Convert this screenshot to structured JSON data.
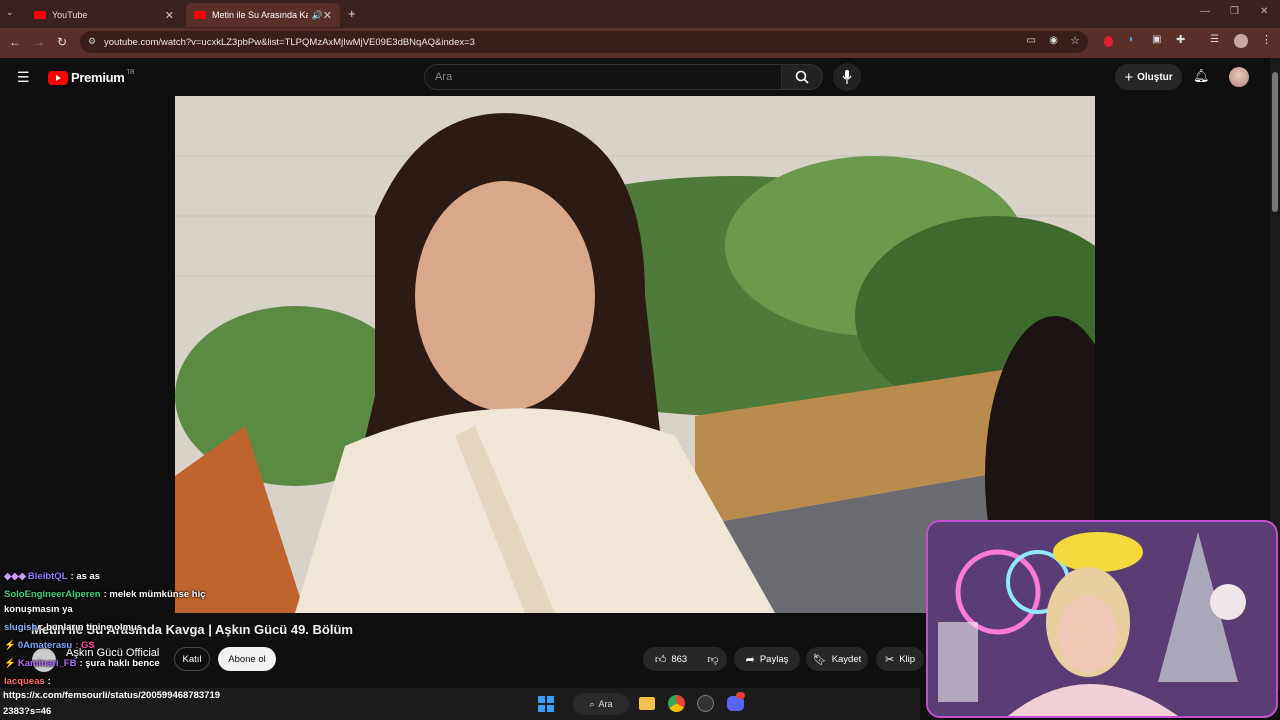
{
  "browser": {
    "tabs": [
      {
        "title": "YouTube",
        "active": false
      },
      {
        "title": "Metin ile Su Arasında Kavga",
        "active": true
      }
    ],
    "url": "youtube.com/watch?v=ucxkLZ3pbPw&list=TLPQMzAxMjIwMjVE09E3dBNqAQ&index=3",
    "new_tab_icon": "plus-icon"
  },
  "youtube": {
    "logo_text": "Premium",
    "region": "TR",
    "search_placeholder": "Ara",
    "create_label": "Oluştur"
  },
  "video": {
    "title": "Metin ile Su Arasında Kavga | Aşkın Gücü 49. Bölüm",
    "channel": "Aşkın Gücü Official",
    "join_label": "Katıl",
    "subscribe_label": "Abone ol",
    "likes": "863",
    "share_label": "Paylaş",
    "save_label": "Kaydet",
    "clip_label": "Klip"
  },
  "chat": [
    {
      "user": "BleibtQL",
      "color": "#8a7dff",
      "message": ": as as"
    },
    {
      "user": "SoloEngineerAlperen",
      "color": "#3fd27a",
      "message": ": melek mümkünse hiç"
    },
    {
      "user": "",
      "color": "#ffffff",
      "message": "konuşmasın ya"
    },
    {
      "user": "slugish",
      "color": "#8fb6ff",
      "message": ": bunların tipine olmus"
    },
    {
      "user": "0Amaterasu",
      "color": "#7ea6ff",
      "message": ": GS"
    },
    {
      "user": "Kaminari_FB",
      "color": "#b36bff",
      "message": ": şura haklı bence"
    },
    {
      "user": "lacqueas",
      "color": "#ff6a6a",
      "message": ":"
    }
  ],
  "status": {
    "link": "https://x.com/femsourli/status/200599468783719",
    "link_cont": "2383?s=46"
  },
  "taskbar": {
    "search_label": "Ara"
  },
  "colors": {
    "youtube_red": "#ff0000",
    "browser_frame": "#5a2e29",
    "webcam_border": "#c44fcf"
  }
}
